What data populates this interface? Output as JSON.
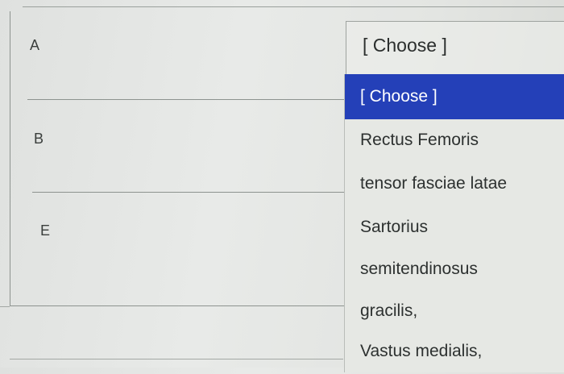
{
  "rows": [
    {
      "letter": "A"
    },
    {
      "letter": "B"
    },
    {
      "letter": "E"
    }
  ],
  "select": {
    "current_value": "[ Choose ]"
  },
  "dropdown": {
    "options": [
      "[ Choose ]",
      "Rectus Femoris",
      "tensor fasciae latae",
      "Sartorius",
      "semitendinosus",
      "gracilis,",
      "Vastus medialis,"
    ],
    "highlighted_index": 0,
    "highlight_color": "#2440b8"
  }
}
